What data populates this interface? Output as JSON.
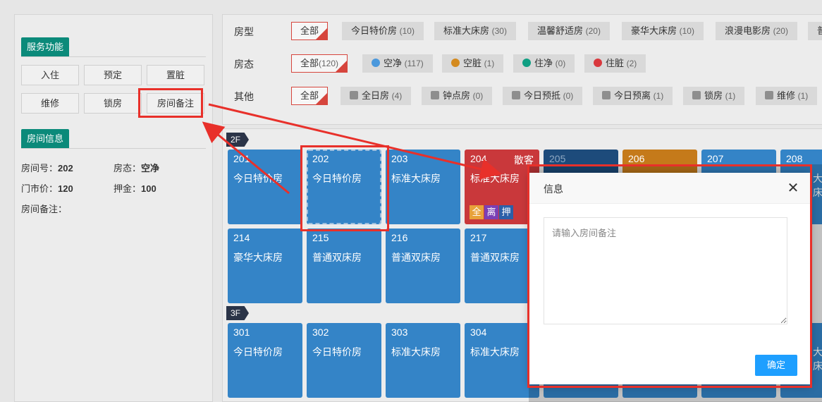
{
  "left": {
    "service": {
      "title": "服务功能",
      "buttons": [
        "入住",
        "预定",
        "置脏",
        "维修",
        "锁房",
        "房间备注"
      ]
    },
    "room_info": {
      "title": "房间信息",
      "room_no_label": "房间号：",
      "room_no": "202",
      "status_label": "房态：",
      "status": "空净",
      "price_label": "门市价：",
      "price": "120",
      "deposit_label": "押金：",
      "deposit": "100",
      "remark_label": "房间备注："
    }
  },
  "filters": {
    "room_type": {
      "label": "房型",
      "all": "全部",
      "items": [
        {
          "name": "今日特价房",
          "count": "(10)"
        },
        {
          "name": "标准大床房",
          "count": "(30)"
        },
        {
          "name": "温馨舒适房",
          "count": "(20)"
        },
        {
          "name": "豪华大床房",
          "count": "(10)"
        },
        {
          "name": "浪漫电影房",
          "count": "(20)"
        },
        {
          "name": "普",
          "count": ""
        }
      ]
    },
    "room_status": {
      "label": "房态",
      "all": "全部",
      "all_count": "(120)",
      "items": [
        {
          "name": "空净",
          "count": "(117)",
          "color": "#4a98dc"
        },
        {
          "name": "空脏",
          "count": "(1)",
          "color": "#d48a1e"
        },
        {
          "name": "住净",
          "count": "(0)",
          "color": "#109f83"
        },
        {
          "name": "住脏",
          "count": "(2)",
          "color": "#d9383d"
        }
      ]
    },
    "other": {
      "label": "其他",
      "all": "全部",
      "items": [
        {
          "name": "全日房",
          "count": "(4)"
        },
        {
          "name": "钟点房",
          "count": "(0)"
        },
        {
          "name": "今日预抵",
          "count": "(0)"
        },
        {
          "name": "今日预离",
          "count": "(1)"
        },
        {
          "name": "锁房",
          "count": "(1)"
        },
        {
          "name": "维修",
          "count": "(1)"
        }
      ]
    }
  },
  "floors": [
    {
      "name": "2F",
      "rooms": [
        {
          "num": "201",
          "type": "今日特价房"
        },
        {
          "num": "202",
          "type": "今日特价房"
        },
        {
          "num": "203",
          "type": "标准大床房"
        },
        {
          "num": "204",
          "type": "标准大床房",
          "guest": "散客",
          "badges": [
            "全",
            "离",
            "押"
          ]
        },
        {
          "num": "205",
          "type": ""
        },
        {
          "num": "206",
          "type": ""
        },
        {
          "num": "207",
          "type": ""
        },
        {
          "num": "208",
          "type": "大床"
        },
        {
          "num": "214",
          "type": "豪华大床房"
        },
        {
          "num": "215",
          "type": "普通双床房"
        },
        {
          "num": "216",
          "type": "普通双床房"
        },
        {
          "num": "217",
          "type": "普通双床房"
        }
      ]
    },
    {
      "name": "3F",
      "rooms": [
        {
          "num": "301",
          "type": "今日特价房"
        },
        {
          "num": "302",
          "type": "今日特价房"
        },
        {
          "num": "303",
          "type": "标准大床房"
        },
        {
          "num": "304",
          "type": "标准大床房"
        },
        {
          "num": "",
          "type": "大床"
        }
      ]
    }
  ],
  "modal": {
    "title": "信息",
    "close": "✕",
    "placeholder": "请输入房间备注",
    "confirm": "确定"
  },
  "colors": {
    "teal": "#0b8a7a",
    "room_blue": "#3484c7",
    "room_red": "#c9383b",
    "highlight_red": "#e8302a",
    "confirm_blue": "#1e9fff"
  }
}
